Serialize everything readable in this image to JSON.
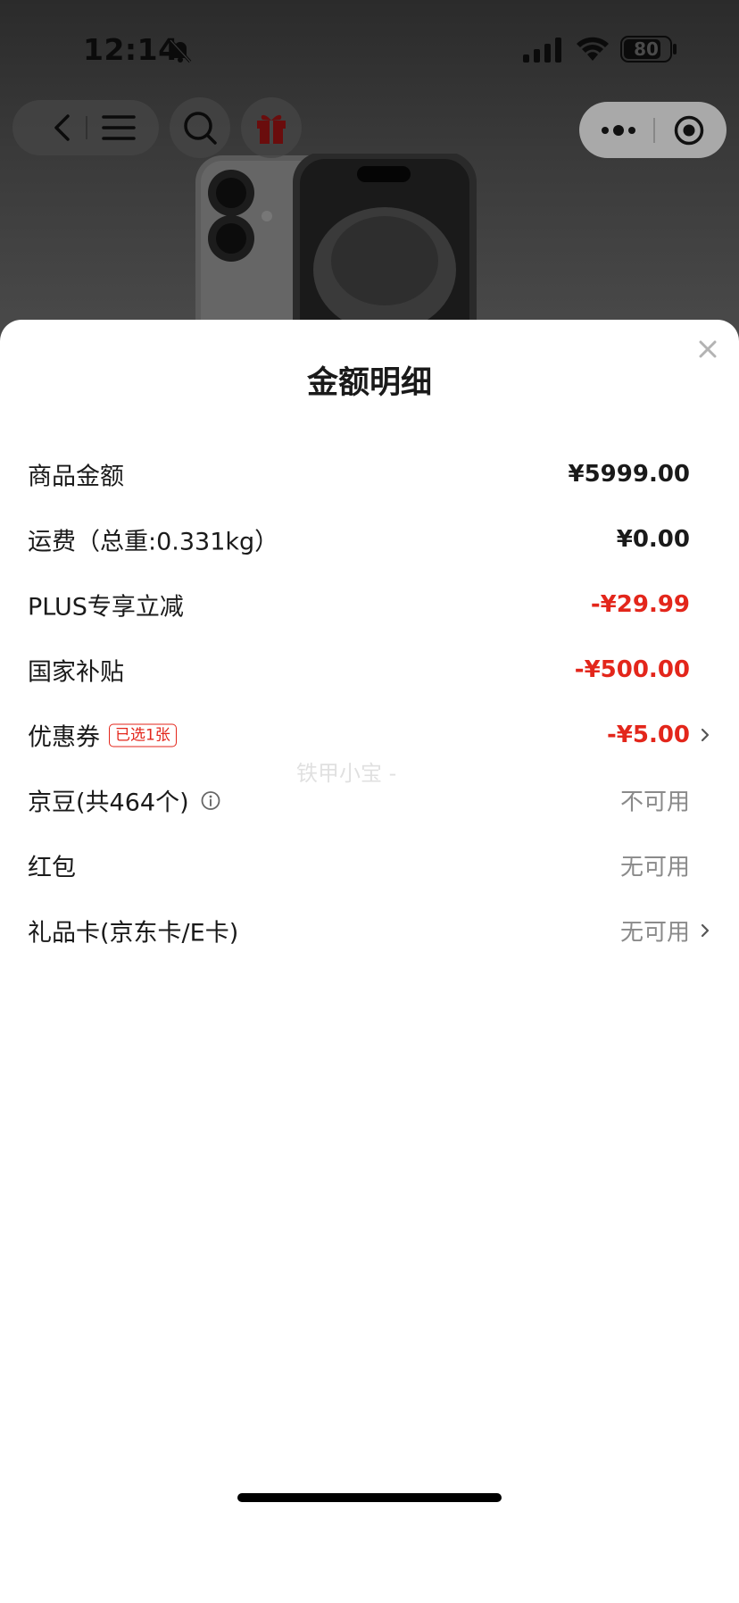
{
  "status_bar": {
    "time": "12:14",
    "battery": "80",
    "battery_level": 0.8
  },
  "sheet": {
    "title": "金额明细",
    "rows": [
      {
        "label": "商品金额",
        "value": "¥5999.00"
      },
      {
        "label": "运费（总重:0.331kg）",
        "value": "¥0.00"
      },
      {
        "label": "PLUS专享立减",
        "value": "-¥29.99"
      },
      {
        "label": "国家补贴",
        "value": "-¥500.00"
      },
      {
        "label": "优惠券",
        "badge": "已选1张",
        "value": "-¥5.00"
      },
      {
        "label": "京豆(共464个)",
        "value": "不可用"
      },
      {
        "label": "红包",
        "value": "无可用"
      },
      {
        "label": "礼品卡(京东卡/E卡)",
        "value": "无可用"
      }
    ],
    "watermark": "铁甲小宝 -"
  },
  "colors": {
    "accent_red": "#e3261b",
    "gray_text": "#8a8a8a"
  }
}
